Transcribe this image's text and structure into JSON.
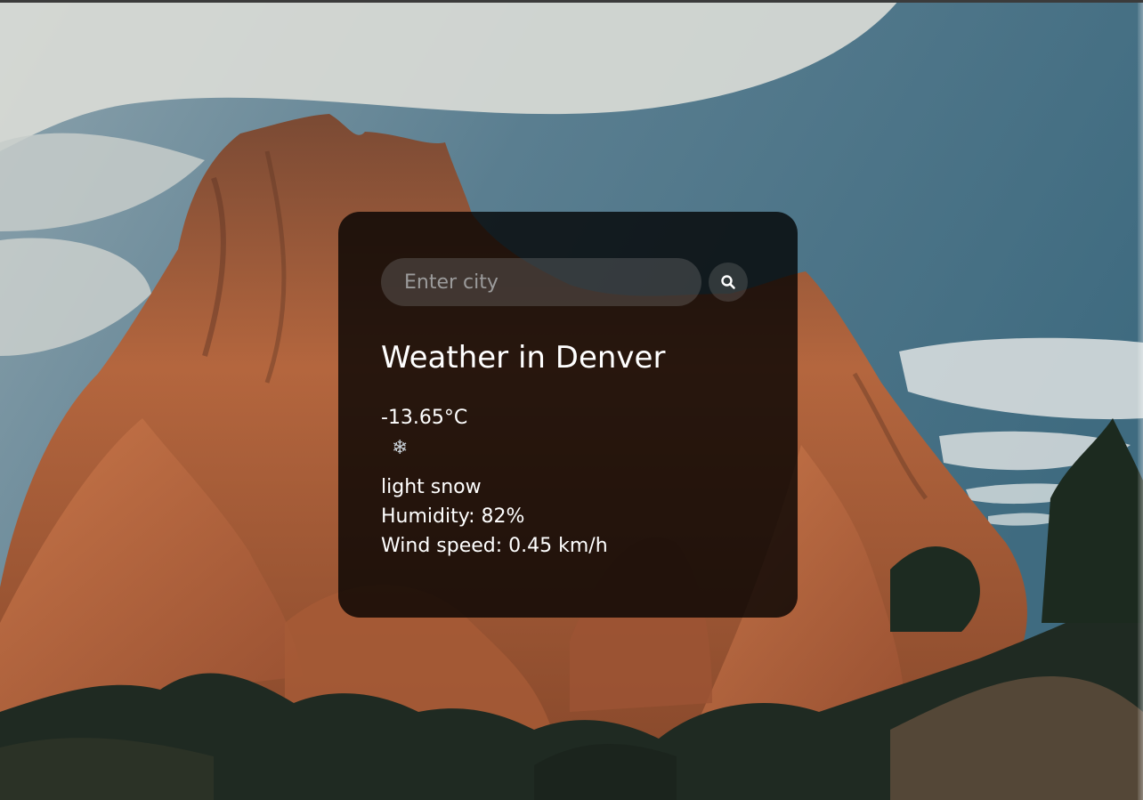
{
  "search": {
    "placeholder": "Enter city",
    "value": ""
  },
  "icons": {
    "search": "search-icon",
    "weather": "snowflake-icon"
  },
  "weather": {
    "title": "Weather in Denver",
    "temperature": "-13.65°C",
    "icon_glyph": "❄",
    "description": "light snow",
    "humidity": "Humidity: 82%",
    "wind": "Wind speed: 0.45 km/h"
  },
  "colors": {
    "card_background": "rgba(0,0,0,0.78)",
    "text": "#ffffff",
    "input_background": "rgba(126,126,126,0.32)"
  }
}
